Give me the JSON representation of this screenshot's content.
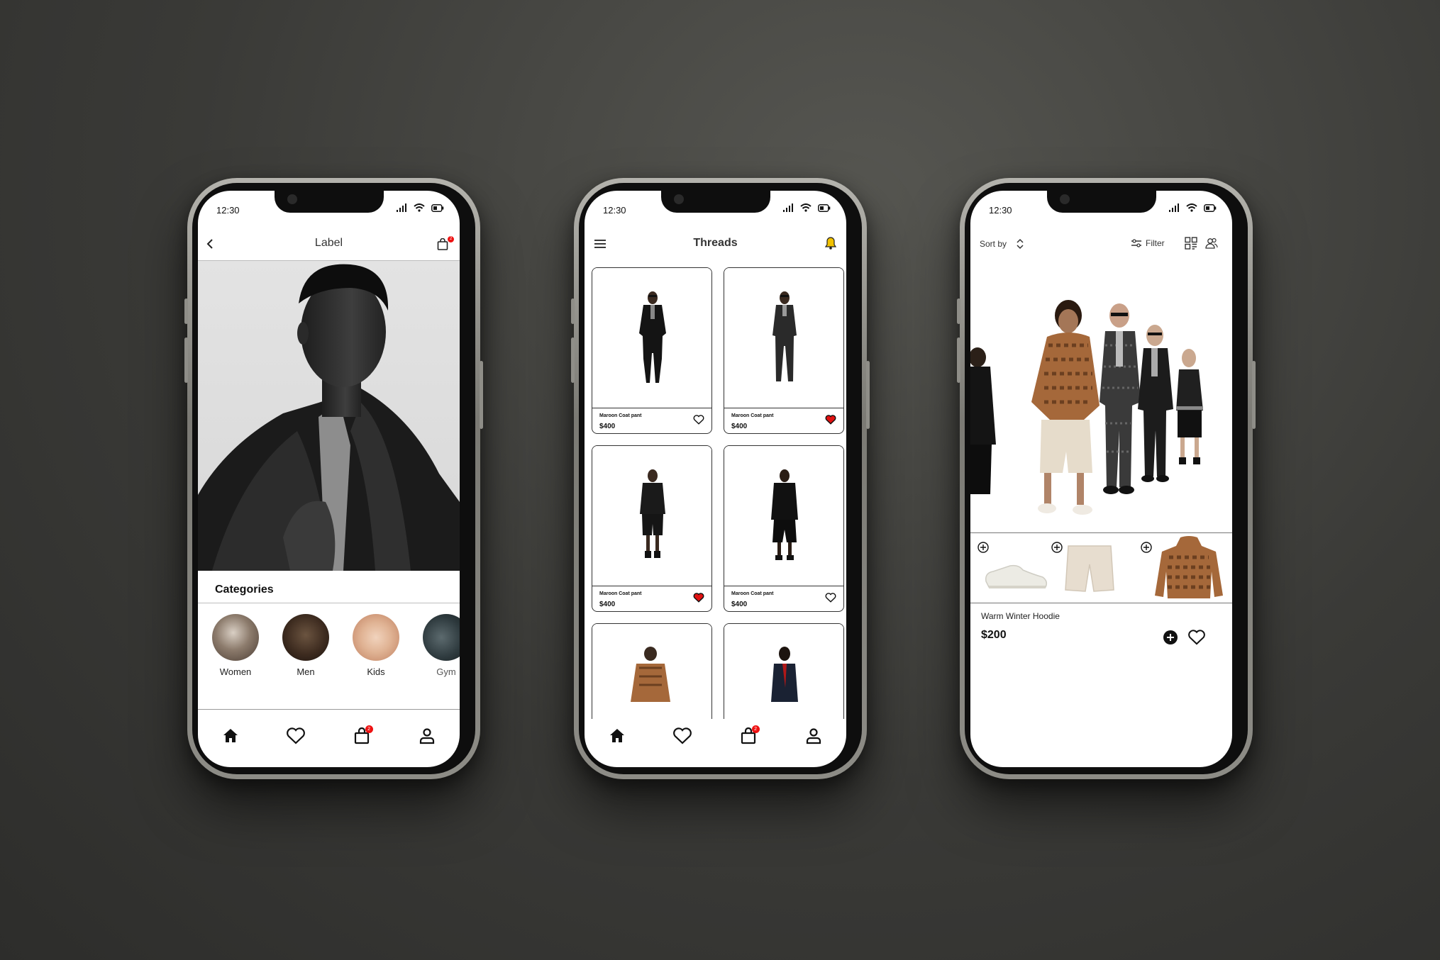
{
  "phone1": {
    "status_time": "12:30",
    "header_title": "Label",
    "cart_badge": "2",
    "categories_title": "Categories",
    "categories": [
      {
        "label": "Women"
      },
      {
        "label": "Men"
      },
      {
        "label": "Kids"
      },
      {
        "label": "Gym"
      }
    ],
    "tab_cart_badge": "2"
  },
  "phone2": {
    "status_time": "12:30",
    "header_title": "Threads",
    "products": [
      {
        "name": "Maroon Coat pant",
        "price": "$400",
        "liked": false
      },
      {
        "name": "Maroon Coat pant",
        "price": "$400",
        "liked": true
      },
      {
        "name": "Maroon Coat pant",
        "price": "$400",
        "liked": true
      },
      {
        "name": "Maroon Coat pant",
        "price": "$400",
        "liked": false
      },
      {
        "name": "",
        "price": "",
        "liked": false
      },
      {
        "name": "",
        "price": "",
        "liked": false
      }
    ],
    "tab_cart_badge": "2"
  },
  "phone3": {
    "status_time": "12:30",
    "sort_label": "Sort by",
    "filter_label": "Filter",
    "product_name": "Warm Winter Hoodie",
    "product_price": "$200",
    "outfit_items": [
      {
        "icon": "sneaker"
      },
      {
        "icon": "shorts"
      },
      {
        "icon": "hoodie"
      }
    ]
  },
  "colors": {
    "background": "#3a3a37",
    "accent_red": "#e11111",
    "bell_yellow": "#f2c200",
    "hoodie_brown": "#a5683a"
  }
}
